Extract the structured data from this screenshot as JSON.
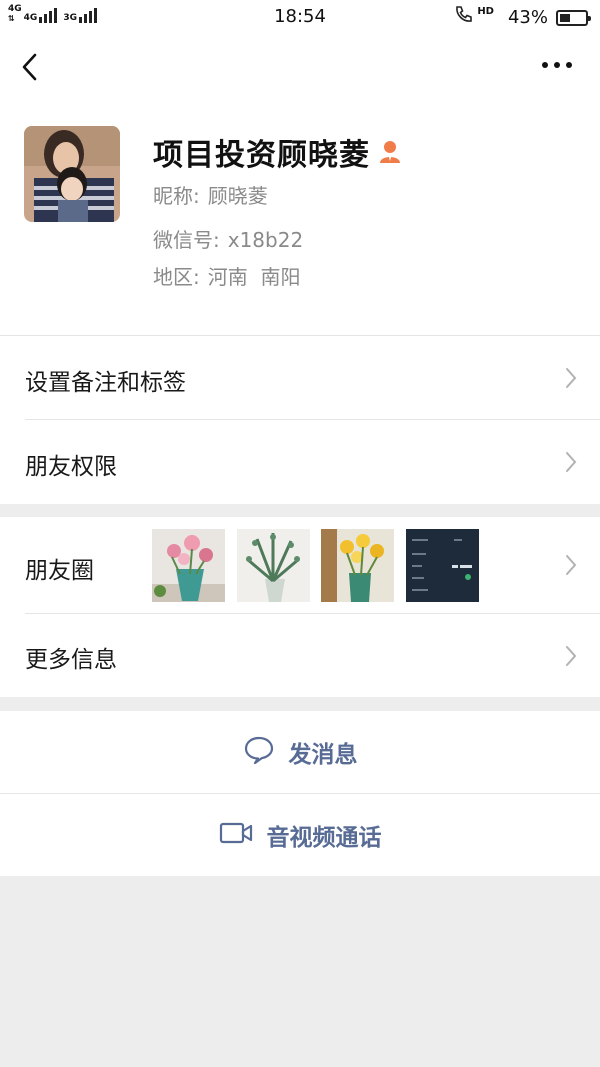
{
  "status_bar": {
    "net1": "4G",
    "net2": "4G",
    "net3": "3G",
    "time": "18:54",
    "hd": "HD",
    "battery_percent_text": "43%",
    "battery_level": 0.43
  },
  "nav": {
    "back_icon": "chevron-left-icon",
    "more_icon": "more-dots-icon"
  },
  "profile": {
    "display_name": "项目投资顾晓菱",
    "nickname_label": "昵称:",
    "nickname": "顾晓菱",
    "wechat_id_label": "微信号:",
    "wechat_id": "x18b22",
    "region_label": "地区:",
    "region": "河南  南阳",
    "badge_icon": "person-badge-icon",
    "badge_color": "#f07c4a"
  },
  "list_1": {
    "remarks_label": "设置备注和标签",
    "permissions_label": "朋友权限"
  },
  "list_2": {
    "moments_label": "朋友圈",
    "moments_thumbnails": [
      "pink-flowers-in-vase",
      "eucalyptus-in-vase",
      "yellow-tulips-in-vase",
      "dark-screenshot"
    ],
    "more_info_label": "更多信息"
  },
  "actions": {
    "message_label": "发消息",
    "message_icon": "chat-bubble-icon",
    "call_label": "音视频通话",
    "call_icon": "video-camera-icon",
    "accent_color": "#576b95"
  }
}
